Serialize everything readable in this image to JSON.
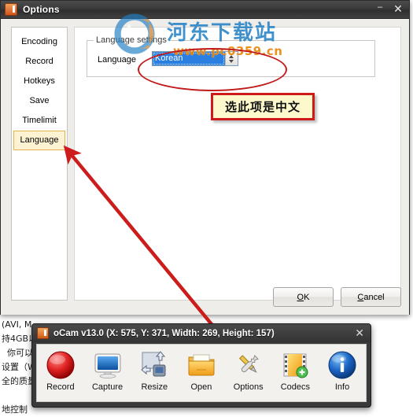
{
  "background_document": {
    "text_lines": [
      "(AVI, M",
      "持4GB以",
      "  你可以",
      "设置（W",
      "全的质量",
      "",
      "地控制"
    ]
  },
  "options_dialog": {
    "title": "Options",
    "app_icon": "ocam-app-icon",
    "window_controls": {
      "minimize": "–",
      "close": "✕",
      "minimize_icon": "minimize-icon",
      "close_icon": "close-icon"
    },
    "sidebar": {
      "items": [
        {
          "label": "Encoding",
          "selected": false
        },
        {
          "label": "Record",
          "selected": false
        },
        {
          "label": "Hotkeys",
          "selected": false
        },
        {
          "label": "Save",
          "selected": false
        },
        {
          "label": "Timelimit",
          "selected": false
        },
        {
          "label": "Language",
          "selected": true
        }
      ]
    },
    "group_language": {
      "legend": "Language settings",
      "field_label": "Language",
      "combo_value": "Korean",
      "spinner_up_icon": "spinner-up-icon",
      "spinner_down_icon": "spinner-down-icon"
    },
    "footer": {
      "ok_label": "OK",
      "ok_accel": "O",
      "ok_rest": "K",
      "cancel_accel": "C",
      "cancel_rest": "ancel",
      "cancel_label": "Cancel"
    }
  },
  "watermark": {
    "site_name": "河东下载站",
    "url": "www.pc0359.cn",
    "logo_icon": "site-logo-icon",
    "color_blue": "#1f7ec4",
    "color_orange": "#e8870c"
  },
  "annotations": {
    "ellipse_color": "#c01a1a",
    "arrow_color": "#cc1c1c",
    "callout": {
      "text": "选此项是中文",
      "background": "#fdf9cd",
      "border_color": "#cf1a1a"
    }
  },
  "ocam_window": {
    "title": "oCam v13.0 (X: 575, Y: 371, Width: 269, Height: 157)",
    "app_icon": "ocam-app-icon",
    "close_icon": "close-icon",
    "close_label": "✕",
    "toolbar_buttons": [
      {
        "label": "Record",
        "icon": "record-icon"
      },
      {
        "label": "Capture",
        "icon": "monitor-icon"
      },
      {
        "label": "Resize",
        "icon": "resize-icon"
      },
      {
        "label": "Open",
        "icon": "folder-icon"
      },
      {
        "label": "Options",
        "icon": "tools-icon"
      },
      {
        "label": "Codecs",
        "icon": "film-plus-icon"
      },
      {
        "label": "Info",
        "icon": "info-icon"
      }
    ]
  }
}
